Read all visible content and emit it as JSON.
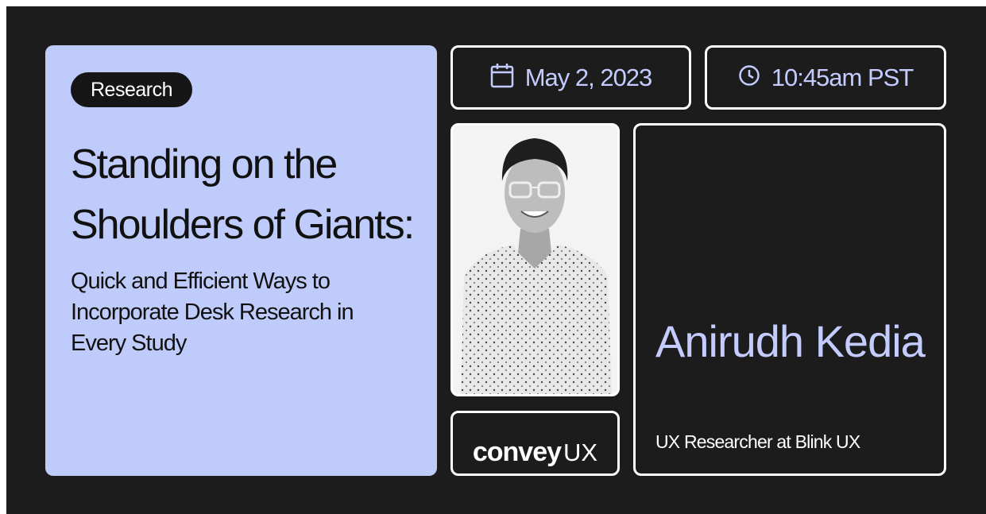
{
  "event": {
    "tag": "Research",
    "title": "Standing on the Shoulders of Giants:",
    "subtitle": "Quick and Efficient Ways to Incorporate Desk Research in Every Study",
    "date": "May 2, 2023",
    "time": "10:45am PST"
  },
  "speaker": {
    "name": "Anirudh Kedia",
    "role": "UX Researcher at Blink UX"
  },
  "brand": {
    "logo_bold": "convey",
    "logo_light": "UX"
  },
  "icons": {
    "date": "calendar-icon",
    "time": "clock-icon"
  },
  "colors": {
    "background": "#1c1c1c",
    "card": "#bfcbfa",
    "accent": "#c4ccff"
  }
}
